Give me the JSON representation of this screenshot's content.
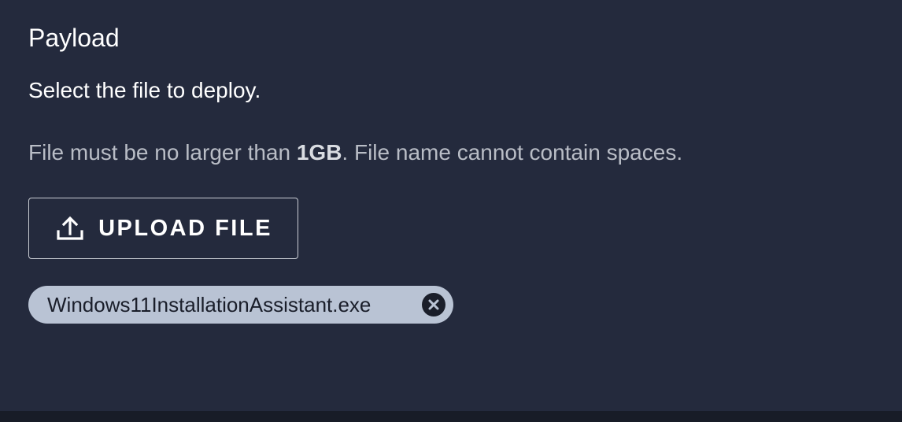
{
  "section": {
    "title": "Payload",
    "instruction": "Select the file to deploy."
  },
  "constraints": {
    "prefix": "File must be no larger than ",
    "size_limit": "1GB",
    "suffix": ". File name cannot contain spaces."
  },
  "upload_button": {
    "label": "UPLOAD FILE",
    "icon": "upload-icon"
  },
  "selected_file": {
    "name": "Windows11InstallationAssistant.exe",
    "remove_icon": "close-circle-icon"
  },
  "colors": {
    "background": "#242a3d",
    "chip_background": "#b9c3d4",
    "muted_text": "#b9bdc6",
    "bottom_bar": "#181c27"
  }
}
